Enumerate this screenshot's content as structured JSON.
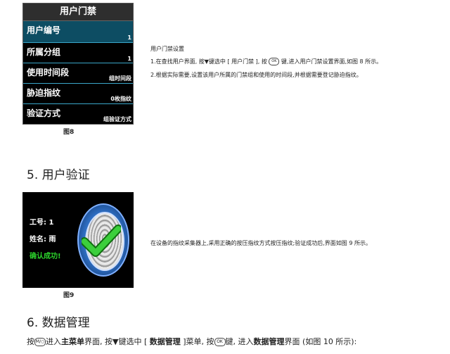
{
  "figure8": {
    "title": "用户门禁",
    "items": [
      {
        "label": "用户编号",
        "value": "1"
      },
      {
        "label": "所属分组",
        "value": "1"
      },
      {
        "label": "使用时间段",
        "value": "组时间段"
      },
      {
        "label": "胁迫指纹",
        "value": "0枚指纹"
      },
      {
        "label": "验证方式",
        "value": "组验证方式"
      }
    ],
    "caption": "图8"
  },
  "section4_text": {
    "heading": "用户门禁设置",
    "step1_a": "1.在查找用户界面, 按▼键选中 [ 用户门禁 ], 按",
    "ok_key": "OK",
    "step1_b": "键,进入用户门禁设置界面,如图 8 所示。",
    "step2": "2.根据实际需要,设置该用户所属的门禁组和使用的时间段,并根据需要登记胁迫指纹。"
  },
  "section5": {
    "heading": "5. 用户验证",
    "device": {
      "id_line": "工号: 1",
      "name_line": "姓名: 雨",
      "status": "确认成功!"
    },
    "caption": "图9",
    "text": "在设备的指纹采集器上,采用正确的按压指纹方式按压指纹;验证成功后,界面如图 9 所示。"
  },
  "section6": {
    "heading": "6. 数据管理",
    "p_a": "按",
    "m_key": "M/○",
    "p_b": "进入",
    "main_menu": "主菜单",
    "p_c": "界面, 按▼键选中 [ ",
    "data_mgmt": "数据管理",
    "p_d": " ]菜单, 按",
    "ok_key": "OK",
    "p_e": "键, 进入",
    "data_mgmt2": "数据管理",
    "p_f": "界面 (如图 10 所示):"
  }
}
